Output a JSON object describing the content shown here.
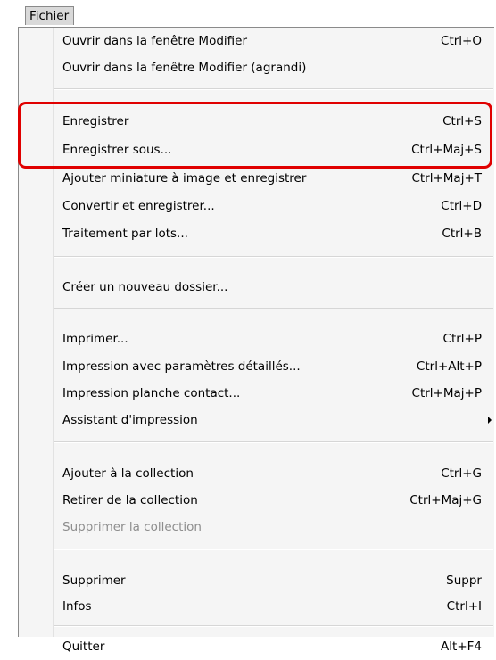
{
  "menu": {
    "title": "Fichier"
  },
  "highlight_color": "#e00000",
  "items": [
    {
      "label": "Ouvrir dans la fenêtre Modifier",
      "shortcut": "Ctrl+O"
    },
    {
      "label": "Ouvrir dans la fenêtre Modifier (agrandi)",
      "shortcut": ""
    },
    {
      "label": "Enregistrer",
      "shortcut": "Ctrl+S"
    },
    {
      "label": "Enregistrer sous...",
      "shortcut": "Ctrl+Maj+S"
    },
    {
      "label": "Ajouter miniature à image et enregistrer",
      "shortcut": "Ctrl+Maj+T"
    },
    {
      "label": "Convertir et enregistrer...",
      "shortcut": "Ctrl+D"
    },
    {
      "label": "Traitement par lots...",
      "shortcut": "Ctrl+B"
    },
    {
      "label": "Créer un nouveau dossier...",
      "shortcut": ""
    },
    {
      "label": "Imprimer...",
      "shortcut": "Ctrl+P"
    },
    {
      "label": "Impression avec paramètres détaillés...",
      "shortcut": "Ctrl+Alt+P"
    },
    {
      "label": "Impression planche contact...",
      "shortcut": "Ctrl+Maj+P"
    },
    {
      "label": "Assistant d'impression",
      "shortcut": ""
    },
    {
      "label": "Ajouter à la collection",
      "shortcut": "Ctrl+G"
    },
    {
      "label": "Retirer de la collection",
      "shortcut": "Ctrl+Maj+G"
    },
    {
      "label": "Supprimer la collection",
      "shortcut": ""
    },
    {
      "label": "Supprimer",
      "shortcut": "Suppr"
    },
    {
      "label": "Infos",
      "shortcut": "Ctrl+I"
    },
    {
      "label": "Quitter",
      "shortcut": "Alt+F4"
    }
  ]
}
